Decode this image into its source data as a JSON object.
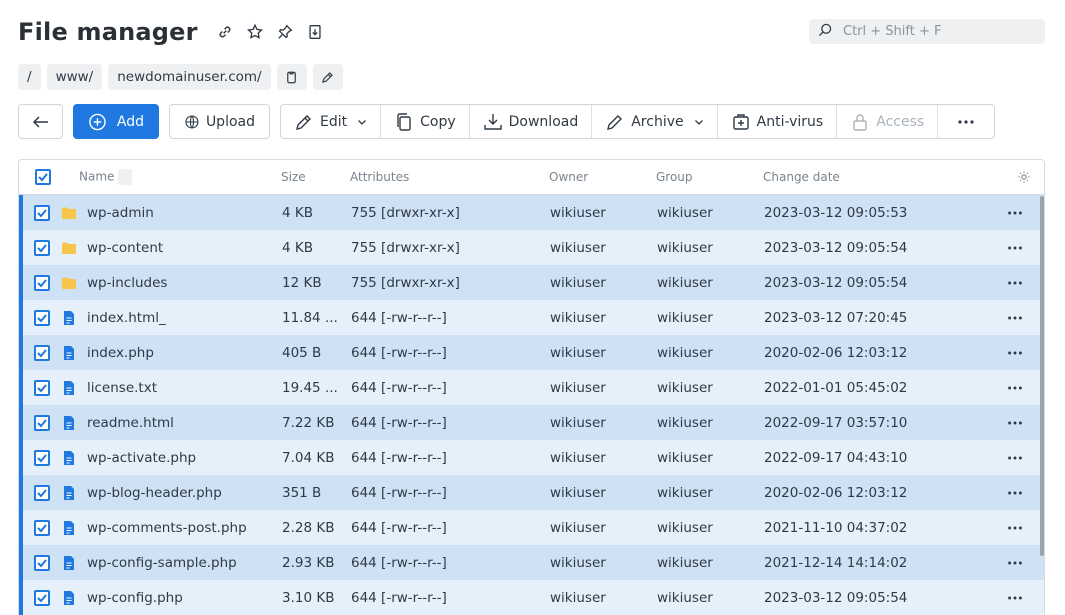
{
  "header": {
    "title": "File manager"
  },
  "search": {
    "placeholder": "Ctrl + Shift + F"
  },
  "breadcrumb": {
    "items": [
      "/",
      "www/",
      "newdomainuser.com/"
    ]
  },
  "toolbar": {
    "add_label": "Add",
    "upload_label": "Upload",
    "edit_label": "Edit",
    "copy_label": "Copy",
    "download_label": "Download",
    "archive_label": "Archive",
    "antivirus_label": "Anti-virus",
    "access_label": "Access"
  },
  "table": {
    "columns": {
      "name": "Name",
      "size": "Size",
      "attributes": "Attributes",
      "owner": "Owner",
      "group": "Group",
      "change_date": "Change date"
    },
    "rows": [
      {
        "type": "folder",
        "name": "wp-admin",
        "size": "4 KB",
        "attributes": "755 [drwxr-xr-x]",
        "owner": "wikiuser",
        "group": "wikiuser",
        "date": "2023-03-12 09:05:53"
      },
      {
        "type": "folder",
        "name": "wp-content",
        "size": "4 KB",
        "attributes": "755 [drwxr-xr-x]",
        "owner": "wikiuser",
        "group": "wikiuser",
        "date": "2023-03-12 09:05:54"
      },
      {
        "type": "folder",
        "name": "wp-includes",
        "size": "12 KB",
        "attributes": "755 [drwxr-xr-x]",
        "owner": "wikiuser",
        "group": "wikiuser",
        "date": "2023-03-12 09:05:54"
      },
      {
        "type": "file",
        "name": "index.html_",
        "size": "11.84 ...",
        "attributes": "644 [-rw-r--r--]",
        "owner": "wikiuser",
        "group": "wikiuser",
        "date": "2023-03-12 07:20:45"
      },
      {
        "type": "file",
        "name": "index.php",
        "size": "405 B",
        "attributes": "644 [-rw-r--r--]",
        "owner": "wikiuser",
        "group": "wikiuser",
        "date": "2020-02-06 12:03:12"
      },
      {
        "type": "file",
        "name": "license.txt",
        "size": "19.45 ...",
        "attributes": "644 [-rw-r--r--]",
        "owner": "wikiuser",
        "group": "wikiuser",
        "date": "2022-01-01 05:45:02"
      },
      {
        "type": "file",
        "name": "readme.html",
        "size": "7.22 KB",
        "attributes": "644 [-rw-r--r--]",
        "owner": "wikiuser",
        "group": "wikiuser",
        "date": "2022-09-17 03:57:10"
      },
      {
        "type": "file",
        "name": "wp-activate.php",
        "size": "7.04 KB",
        "attributes": "644 [-rw-r--r--]",
        "owner": "wikiuser",
        "group": "wikiuser",
        "date": "2022-09-17 04:43:10"
      },
      {
        "type": "file",
        "name": "wp-blog-header.php",
        "size": "351 B",
        "attributes": "644 [-rw-r--r--]",
        "owner": "wikiuser",
        "group": "wikiuser",
        "date": "2020-02-06 12:03:12"
      },
      {
        "type": "file",
        "name": "wp-comments-post.php",
        "size": "2.28 KB",
        "attributes": "644 [-rw-r--r--]",
        "owner": "wikiuser",
        "group": "wikiuser",
        "date": "2021-11-10 04:37:02"
      },
      {
        "type": "file",
        "name": "wp-config-sample.php",
        "size": "2.93 KB",
        "attributes": "644 [-rw-r--r--]",
        "owner": "wikiuser",
        "group": "wikiuser",
        "date": "2021-12-14 14:14:02"
      },
      {
        "type": "file",
        "name": "wp-config.php",
        "size": "3.10 KB",
        "attributes": "644 [-rw-r--r--]",
        "owner": "wikiuser",
        "group": "wikiuser",
        "date": "2023-03-12 09:05:54"
      }
    ]
  },
  "colors": {
    "accent": "#1f79e0",
    "row_odd": "#cfe1f5",
    "row_even": "#e6f0fa",
    "folder": "#f7c54a",
    "file": "#1f79e0"
  },
  "icons": [
    "link-icon",
    "star-icon",
    "pin-icon",
    "bookmark-icon",
    "search-icon",
    "copy-path-icon",
    "edit-path-icon",
    "back-arrow-icon",
    "plus-circle-icon",
    "globe-upload-icon",
    "pencil-icon",
    "copy-icon",
    "download-icon",
    "archive-icon",
    "antivirus-icon",
    "lock-icon",
    "more-icon",
    "gear-icon",
    "folder-icon",
    "file-icon"
  ]
}
